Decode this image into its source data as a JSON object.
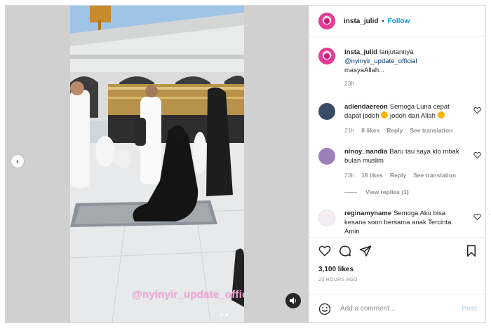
{
  "header": {
    "username": "insta_julid",
    "separator": "•",
    "follow_label": "Follow"
  },
  "media": {
    "watermark": "@nyinyir_update_official",
    "prev_arrow": "‹",
    "dots": 2,
    "active_dot": 2,
    "sound_icon": "speaker-icon"
  },
  "caption": {
    "username": "insta_julid",
    "text_part1": "lanjutannya",
    "mention": "@nyinyir_update_official",
    "text_part2": "masyaAllah...",
    "time": "23h"
  },
  "comments": [
    {
      "username": "adiendaereon",
      "text_a": "Semoga Luna cepat dapat jodoh",
      "text_b": "jodoh dari Allah",
      "time": "21h",
      "likes": "8 likes",
      "reply": "Reply",
      "translate": "See translation",
      "avatar_color": "#3a4a66"
    },
    {
      "username": "ninoy_nandia",
      "text_a": "Baru tau saya klo mbak bulan muslim",
      "time": "23h",
      "likes": "18 likes",
      "reply": "Reply",
      "translate": "See translation",
      "avatar_color": "#9b7fb8",
      "view_replies": "View replies (1)"
    },
    {
      "username": "reginamyname",
      "text_a": "Semoga Aku bisa kesana soon bersama anak Tercinta. Amin",
      "avatar_color": "#f4eef2"
    }
  ],
  "actions": {
    "like_icon": "heart-icon",
    "comment_icon": "comment-icon",
    "share_icon": "share-icon",
    "save_icon": "bookmark-icon",
    "likes": "3,100 likes",
    "time": "23 HOURS AGO"
  },
  "composer": {
    "placeholder": "Add a comment...",
    "post_label": "Post",
    "emoji_icon": "smiley-icon"
  },
  "colors": {
    "follow": "#0095f6",
    "mention": "#00376b",
    "watermark": "#f3a8d4",
    "muted": "#8e8e8e"
  }
}
